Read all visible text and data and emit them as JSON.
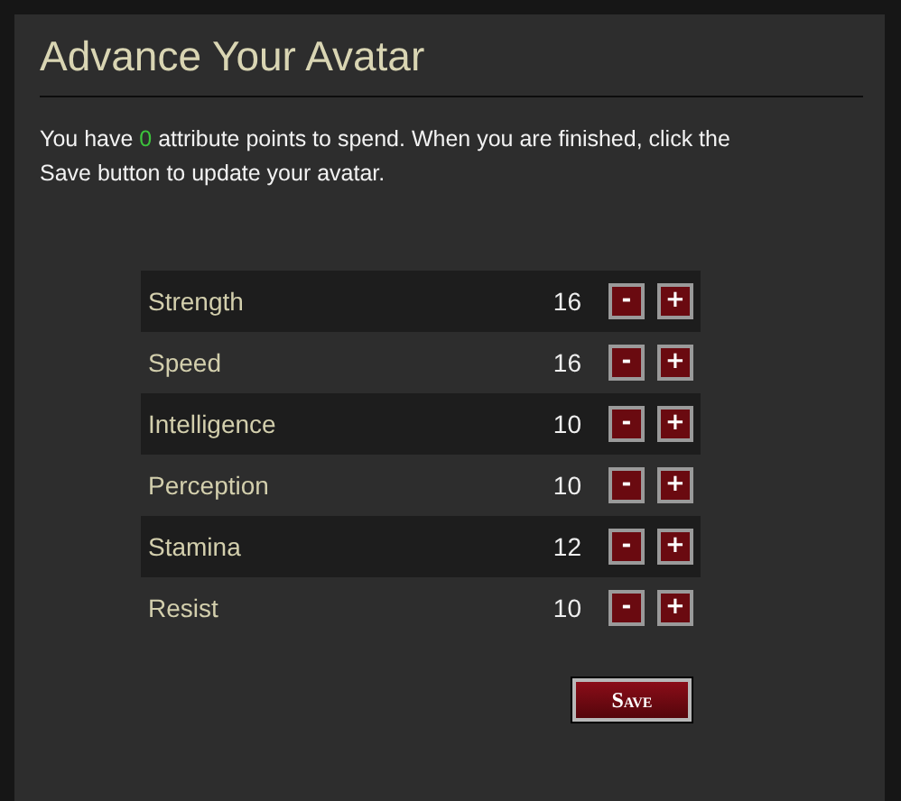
{
  "title": "Advance Your Avatar",
  "intro": {
    "before": "You have ",
    "points": "0",
    "after": " attribute points to spend. When you are finished, click the Save button to update your avatar."
  },
  "attributes": [
    {
      "name": "Strength",
      "value": "16",
      "minus": "-",
      "plus": "+"
    },
    {
      "name": "Speed",
      "value": "16",
      "minus": "-",
      "plus": "+"
    },
    {
      "name": "Intelligence",
      "value": "10",
      "minus": "-",
      "plus": "+"
    },
    {
      "name": "Perception",
      "value": "10",
      "minus": "-",
      "plus": "+"
    },
    {
      "name": "Stamina",
      "value": "12",
      "minus": "-",
      "plus": "+"
    },
    {
      "name": "Resist",
      "value": "10",
      "minus": "-",
      "plus": "+"
    }
  ],
  "save_button": "Save"
}
